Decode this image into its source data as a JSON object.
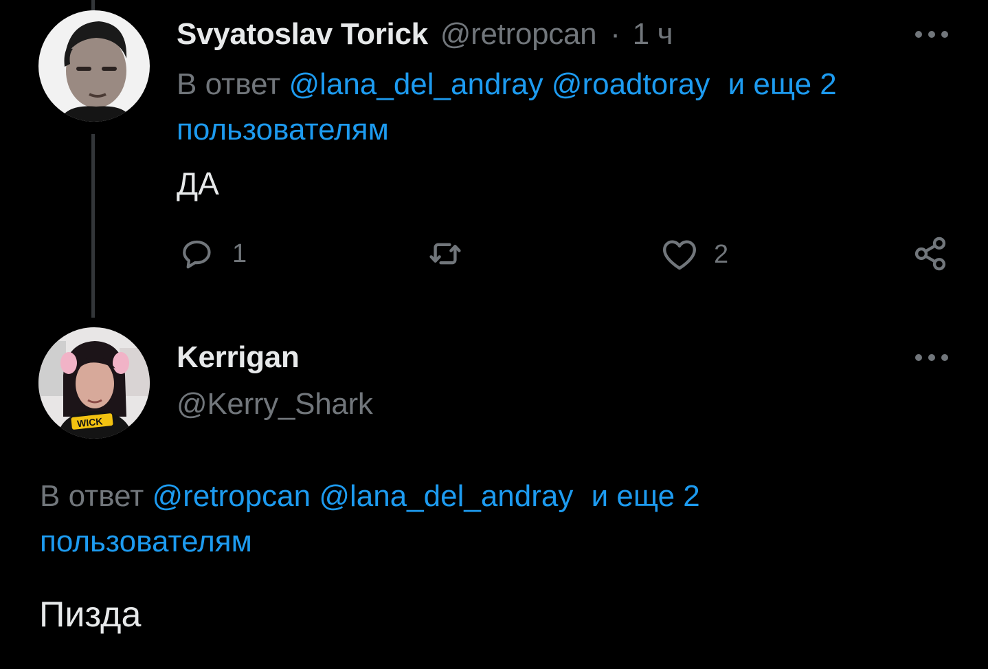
{
  "tweet1": {
    "display_name": "Svyatoslav Torick",
    "handle": "@retropcan",
    "separator": "·",
    "time": "1 ч",
    "reply_prefix": "В ответ",
    "mention1": "@lana_del_andray",
    "mention2": "@roadtoray",
    "more_users": "и еще 2",
    "more_users_cont": "пользователям",
    "text": "ДА",
    "actions": {
      "reply_count": "1",
      "retweet_count": "",
      "like_count": "2"
    }
  },
  "tweet2": {
    "display_name": "Kerrigan",
    "handle": "@Kerry_Shark",
    "reply_prefix": "В ответ",
    "mention1": "@retropcan",
    "mention2": "@lana_del_andray",
    "more_users": "и еще 2",
    "more_users_cont": "пользователям",
    "text": "Пизда"
  },
  "icons": {
    "more": "more-horizontal-icon",
    "reply": "reply-bubble-icon",
    "retweet": "retweet-icon",
    "like": "heart-icon",
    "share": "share-icon"
  },
  "colors": {
    "background": "#000000",
    "text": "#e7e9ea",
    "muted": "#71767b",
    "link": "#1d9bf0",
    "thread_line": "#333639"
  }
}
